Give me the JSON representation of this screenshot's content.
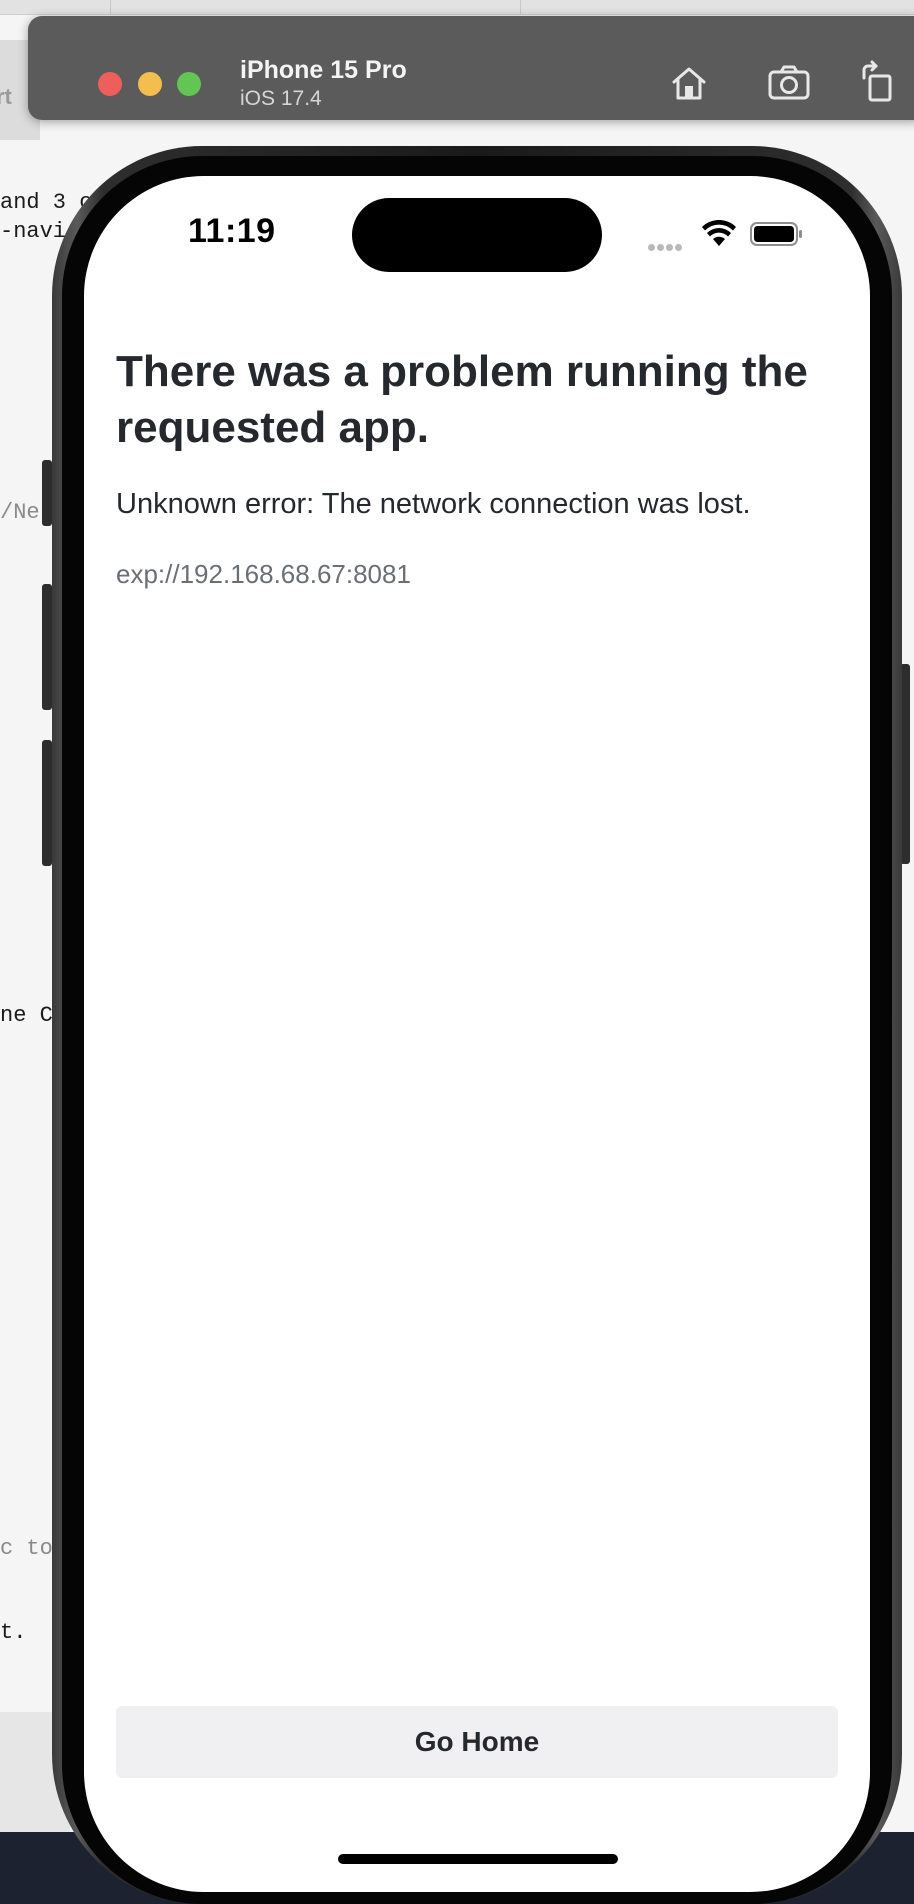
{
  "simulator": {
    "device_name": "iPhone 15 Pro",
    "os_version": "iOS 17.4",
    "toolbar": {
      "home_icon": "home-icon",
      "screenshot_icon": "camera-icon",
      "rotate_icon": "rotate-icon"
    }
  },
  "background_editor": {
    "header_fragment": "rt",
    "lines": [
      "and 3 c",
      "-navi",
      "/Ne",
      "ne Ca",
      "c to",
      "t."
    ]
  },
  "status_bar": {
    "time": "11:19"
  },
  "error_screen": {
    "title": "There was a problem running the requested app.",
    "message": "Unknown error: The network connection was lost.",
    "url": "exp://192.168.68.67:8081",
    "button_label": "Go Home"
  },
  "colors": {
    "titlebar": "#5b5b5b",
    "close": "#ec5f5a",
    "minimize": "#f3be4f",
    "maximize": "#62c554",
    "text_primary": "#25292e",
    "text_secondary": "#6a6f76",
    "button_bg": "#f0f0f3"
  }
}
